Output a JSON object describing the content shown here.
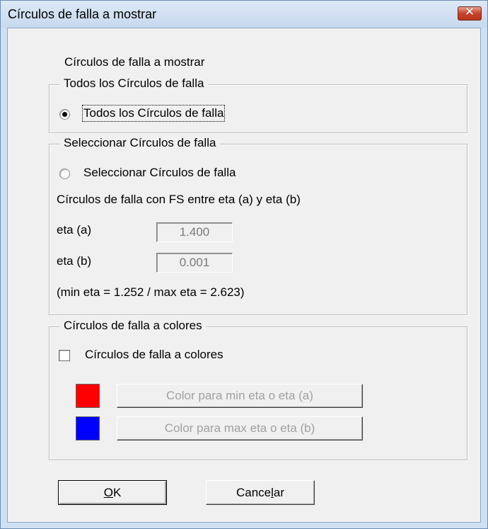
{
  "window": {
    "title": "Círculos de falla a mostrar"
  },
  "header_label": "Círculos de falla a mostrar",
  "group_all": {
    "legend": "Todos los Círculos de falla",
    "radio_label": "Todos los Círculos de falla",
    "selected": true
  },
  "group_select": {
    "legend": "Seleccionar Círculos de falla",
    "radio_label": "Seleccionar Círculos de falla",
    "selected": false,
    "range_text": "Círculos de falla con FS entre eta (a) y   eta (b)",
    "eta_a_label": "eta (a)",
    "eta_a_value": "1.400",
    "eta_b_label": "eta (b)",
    "eta_b_value": "0.001",
    "minmax_text": "(min eta = 1.252 / max eta = 2.623)"
  },
  "group_colors": {
    "legend": "Círculos de falla a colores",
    "checkbox_label": "Círculos de falla a colores",
    "checked": false,
    "min_color": "#ff0000",
    "max_color": "#0000ff",
    "min_button_label": "Color para  min eta o eta (a)",
    "max_button_label": "Color para  max eta o eta (b)"
  },
  "buttons": {
    "ok_prefix": "",
    "ok_mnemonic": "O",
    "ok_suffix": "K",
    "cancel_prefix": "Cance",
    "cancel_mnemonic": "l",
    "cancel_suffix": "ar"
  },
  "icons": {
    "close": "close-icon"
  }
}
